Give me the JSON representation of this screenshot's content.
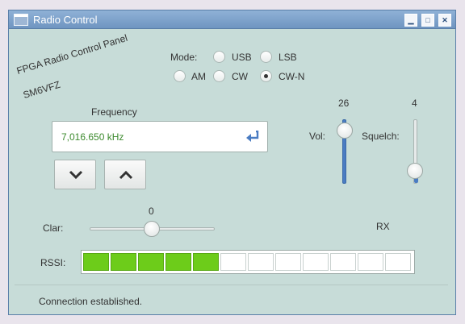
{
  "window": {
    "title": "Radio Control"
  },
  "title_buttons": {
    "minimize": "▁",
    "maximize": "□",
    "close": "✕"
  },
  "logo": {
    "line1": "FPGA Radio Control Panel",
    "line2": "SM6VFZ"
  },
  "mode": {
    "label": "Mode:",
    "options": [
      {
        "label": "USB",
        "checked": false
      },
      {
        "label": "LSB",
        "checked": false
      },
      {
        "label": "AM",
        "checked": false
      },
      {
        "label": "CW",
        "checked": false
      },
      {
        "label": "CW-N",
        "checked": true
      }
    ]
  },
  "frequency": {
    "label": "Frequency",
    "value": "7,016.650 kHz",
    "enter_icon": "enter-icon"
  },
  "step": {
    "down_icon": "chevron-down-icon",
    "up_icon": "chevron-up-icon"
  },
  "volume": {
    "label": "Vol:",
    "value": "26",
    "level": 0.26
  },
  "squelch": {
    "label": "Squelch:",
    "value": "4",
    "level": 0.04
  },
  "clarifier": {
    "label": "Clar:",
    "value": "0",
    "level": 0.5
  },
  "rx_status": "RX",
  "rssi": {
    "label": "RSSI:",
    "segments_total": 12,
    "segments_lit": 5,
    "lit_color": "#6dcc1a"
  },
  "status": {
    "text": "Connection established."
  }
}
